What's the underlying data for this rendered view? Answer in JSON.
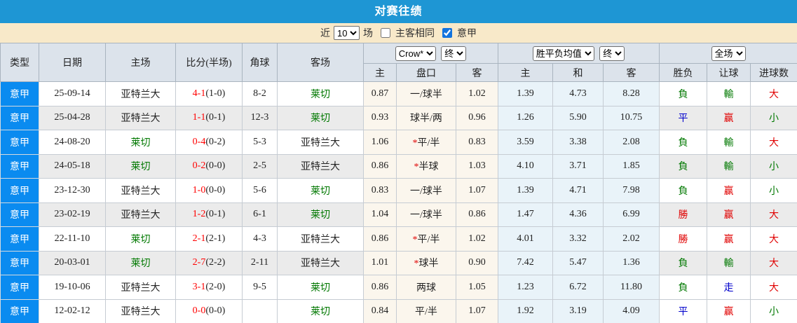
{
  "title": "对赛往绩",
  "filter": {
    "near_label": "近",
    "count_value": "10",
    "games_label": "场",
    "same_venue_label": "主客相同",
    "same_venue_checked": false,
    "league_label": "意甲",
    "league_checked": true
  },
  "table": {
    "headers": {
      "type": "类型",
      "date": "日期",
      "home": "主场",
      "score": "比分(半场)",
      "corner": "角球",
      "away": "客场",
      "odds_group": {
        "select1": "Crow*",
        "select2": "终",
        "cols": [
          "主",
          "盘口",
          "客"
        ]
      },
      "avg_group": {
        "select1": "胜平负均值",
        "select2": "终",
        "cols": [
          "主",
          "和",
          "客"
        ]
      },
      "result_group": {
        "select1": "全场",
        "cols": [
          "胜负",
          "让球",
          "进球数"
        ]
      }
    },
    "rows": [
      {
        "league": "意甲",
        "date": "25-09-14",
        "home": "亚特兰大",
        "home_color": "black",
        "score": "4-1",
        "half": "(1-0)",
        "corner": "8-2",
        "away": "莱切",
        "away_color": "green",
        "o1": "0.87",
        "handicap": "一/球半",
        "handicap_star": false,
        "o2": "1.02",
        "a1": "1.39",
        "a2": "4.73",
        "a3": "8.28",
        "r1": {
          "t": "負",
          "c": "green"
        },
        "r2": {
          "t": "輸",
          "c": "green"
        },
        "r3": {
          "t": "大",
          "c": "red"
        }
      },
      {
        "league": "意甲",
        "date": "25-04-28",
        "home": "亚特兰大",
        "home_color": "black",
        "score": "1-1",
        "half": "(0-1)",
        "corner": "12-3",
        "away": "莱切",
        "away_color": "green",
        "o1": "0.93",
        "handicap": "球半/两",
        "handicap_star": false,
        "o2": "0.96",
        "a1": "1.26",
        "a2": "5.90",
        "a3": "10.75",
        "r1": {
          "t": "平",
          "c": "blue"
        },
        "r2": {
          "t": "赢",
          "c": "red"
        },
        "r3": {
          "t": "小",
          "c": "green"
        }
      },
      {
        "league": "意甲",
        "date": "24-08-20",
        "home": "莱切",
        "home_color": "green",
        "score": "0-4",
        "half": "(0-2)",
        "corner": "5-3",
        "away": "亚特兰大",
        "away_color": "black",
        "o1": "1.06",
        "handicap": "平/半",
        "handicap_star": true,
        "o2": "0.83",
        "a1": "3.59",
        "a2": "3.38",
        "a3": "2.08",
        "r1": {
          "t": "負",
          "c": "green"
        },
        "r2": {
          "t": "輸",
          "c": "green"
        },
        "r3": {
          "t": "大",
          "c": "red"
        }
      },
      {
        "league": "意甲",
        "date": "24-05-18",
        "home": "莱切",
        "home_color": "green",
        "score": "0-2",
        "half": "(0-0)",
        "corner": "2-5",
        "away": "亚特兰大",
        "away_color": "black",
        "o1": "0.86",
        "handicap": "半球",
        "handicap_star": true,
        "o2": "1.03",
        "a1": "4.10",
        "a2": "3.71",
        "a3": "1.85",
        "r1": {
          "t": "負",
          "c": "green"
        },
        "r2": {
          "t": "輸",
          "c": "green"
        },
        "r3": {
          "t": "小",
          "c": "green"
        }
      },
      {
        "league": "意甲",
        "date": "23-12-30",
        "home": "亚特兰大",
        "home_color": "black",
        "score": "1-0",
        "half": "(0-0)",
        "corner": "5-6",
        "away": "莱切",
        "away_color": "green",
        "o1": "0.83",
        "handicap": "一/球半",
        "handicap_star": false,
        "o2": "1.07",
        "a1": "1.39",
        "a2": "4.71",
        "a3": "7.98",
        "r1": {
          "t": "負",
          "c": "green"
        },
        "r2": {
          "t": "赢",
          "c": "red"
        },
        "r3": {
          "t": "小",
          "c": "green"
        }
      },
      {
        "league": "意甲",
        "date": "23-02-19",
        "home": "亚特兰大",
        "home_color": "black",
        "score": "1-2",
        "half": "(0-1)",
        "corner": "6-1",
        "away": "莱切",
        "away_color": "green",
        "o1": "1.04",
        "handicap": "一/球半",
        "handicap_star": false,
        "o2": "0.86",
        "a1": "1.47",
        "a2": "4.36",
        "a3": "6.99",
        "r1": {
          "t": "勝",
          "c": "red"
        },
        "r2": {
          "t": "赢",
          "c": "red"
        },
        "r3": {
          "t": "大",
          "c": "red"
        }
      },
      {
        "league": "意甲",
        "date": "22-11-10",
        "home": "莱切",
        "home_color": "green",
        "score": "2-1",
        "half": "(2-1)",
        "corner": "4-3",
        "away": "亚特兰大",
        "away_color": "black",
        "o1": "0.86",
        "handicap": "平/半",
        "handicap_star": true,
        "o2": "1.02",
        "a1": "4.01",
        "a2": "3.32",
        "a3": "2.02",
        "r1": {
          "t": "勝",
          "c": "red"
        },
        "r2": {
          "t": "赢",
          "c": "red"
        },
        "r3": {
          "t": "大",
          "c": "red"
        }
      },
      {
        "league": "意甲",
        "date": "20-03-01",
        "home": "莱切",
        "home_color": "green",
        "score": "2-7",
        "half": "(2-2)",
        "corner": "2-11",
        "away": "亚特兰大",
        "away_color": "black",
        "o1": "1.01",
        "handicap": "球半",
        "handicap_star": true,
        "o2": "0.90",
        "a1": "7.42",
        "a2": "5.47",
        "a3": "1.36",
        "r1": {
          "t": "負",
          "c": "green"
        },
        "r2": {
          "t": "輸",
          "c": "green"
        },
        "r3": {
          "t": "大",
          "c": "red"
        }
      },
      {
        "league": "意甲",
        "date": "19-10-06",
        "home": "亚特兰大",
        "home_color": "black",
        "score": "3-1",
        "half": "(2-0)",
        "corner": "9-5",
        "away": "莱切",
        "away_color": "green",
        "o1": "0.86",
        "handicap": "两球",
        "handicap_star": false,
        "o2": "1.05",
        "a1": "1.23",
        "a2": "6.72",
        "a3": "11.80",
        "r1": {
          "t": "負",
          "c": "green"
        },
        "r2": {
          "t": "走",
          "c": "blue"
        },
        "r3": {
          "t": "大",
          "c": "red"
        }
      },
      {
        "league": "意甲",
        "date": "12-02-12",
        "home": "亚特兰大",
        "home_color": "black",
        "score": "0-0",
        "half": "(0-0)",
        "corner": "",
        "away": "莱切",
        "away_color": "green",
        "o1": "0.84",
        "handicap": "平/半",
        "handicap_star": false,
        "o2": "1.07",
        "a1": "1.92",
        "a2": "3.19",
        "a3": "4.09",
        "r1": {
          "t": "平",
          "c": "blue"
        },
        "r2": {
          "t": "赢",
          "c": "red"
        },
        "r3": {
          "t": "小",
          "c": "green"
        }
      }
    ]
  },
  "colors": {
    "title_bg": "#1E96D4",
    "filter_bg": "#F8E9C9",
    "header_bg": "#DCE3EB",
    "league_cell_bg": "#0A8BF0",
    "row_stripe": "#EBEBEB",
    "odds_col_bg": "#FBF6ED",
    "avg_col_bg": "#E9F3F9",
    "loss_green": "#007800",
    "win_red": "#E00000",
    "draw_blue": "#0000CC",
    "score_red": "#FF0000"
  }
}
